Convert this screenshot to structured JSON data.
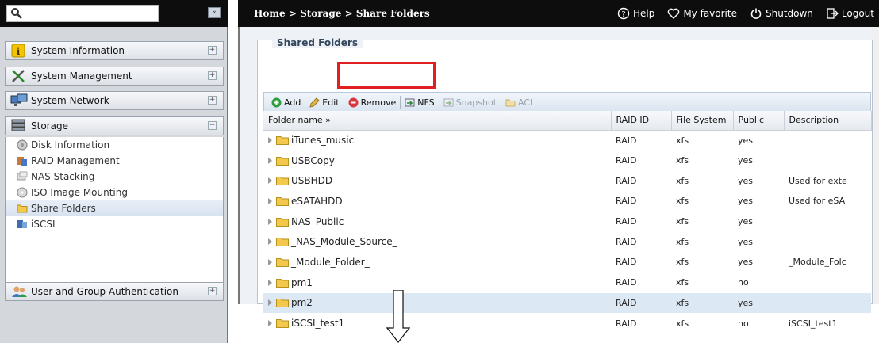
{
  "header": {
    "breadcrumb": "Home > Storage > Share Folders",
    "nav": [
      {
        "label": "Help",
        "icon": "help-icon"
      },
      {
        "label": "My favorite",
        "icon": "heart-icon"
      },
      {
        "label": "Shutdown",
        "icon": "power-icon"
      },
      {
        "label": "Logout",
        "icon": "logout-icon"
      }
    ],
    "collapse_label": "«"
  },
  "sidebar": {
    "panels": [
      {
        "label": "System Information",
        "icon": "info-icon"
      },
      {
        "label": "System Management",
        "icon": "tools-icon"
      },
      {
        "label": "System Network",
        "icon": "network-icon"
      },
      {
        "label": "Storage",
        "icon": "storage-icon"
      },
      {
        "label": "User and Group Authentication",
        "icon": "users-icon"
      }
    ],
    "storage_items": [
      {
        "label": "Disk Information",
        "icon": "disk-icon"
      },
      {
        "label": "RAID Management",
        "icon": "raid-icon"
      },
      {
        "label": "NAS Stacking",
        "icon": "stacking-icon"
      },
      {
        "label": "ISO Image Mounting",
        "icon": "iso-icon"
      },
      {
        "label": "Share Folders",
        "icon": "folder-icon",
        "active": true
      },
      {
        "label": "iSCSI",
        "icon": "iscsi-icon"
      }
    ],
    "expand_glyph": "+",
    "collapse_glyph": "−"
  },
  "main": {
    "section_title": "Shared Folders",
    "toolbar": [
      {
        "label": "Add",
        "icon": "add-icon",
        "enabled": true
      },
      {
        "label": "Edit",
        "icon": "edit-icon",
        "enabled": true
      },
      {
        "label": "Remove",
        "icon": "remove-icon",
        "enabled": true,
        "highlighted": true
      },
      {
        "label": "NFS",
        "icon": "nfs-icon",
        "enabled": true
      },
      {
        "label": "Snapshot",
        "icon": "snapshot-icon",
        "enabled": false
      },
      {
        "label": "ACL",
        "icon": "acl-icon",
        "enabled": false
      }
    ],
    "columns": [
      "Folder name »",
      "RAID ID",
      "File System",
      "Public",
      "Description"
    ],
    "rows": [
      {
        "name": "iTunes_music",
        "raid": "RAID",
        "fs": "xfs",
        "public": "yes",
        "desc": ""
      },
      {
        "name": "USBCopy",
        "raid": "RAID",
        "fs": "xfs",
        "public": "yes",
        "desc": ""
      },
      {
        "name": "USBHDD",
        "raid": "RAID",
        "fs": "xfs",
        "public": "yes",
        "desc": "Used for exte"
      },
      {
        "name": "eSATAHDD",
        "raid": "RAID",
        "fs": "xfs",
        "public": "yes",
        "desc": "Used for eSA"
      },
      {
        "name": "NAS_Public",
        "raid": "RAID",
        "fs": "xfs",
        "public": "yes",
        "desc": ""
      },
      {
        "name": "_NAS_Module_Source_",
        "raid": "RAID",
        "fs": "xfs",
        "public": "yes",
        "desc": ""
      },
      {
        "name": "_Module_Folder_",
        "raid": "RAID",
        "fs": "xfs",
        "public": "yes",
        "desc": "_Module_Folc"
      },
      {
        "name": "pm1",
        "raid": "RAID",
        "fs": "xfs",
        "public": "no",
        "desc": ""
      },
      {
        "name": "pm2",
        "raid": "RAID",
        "fs": "xfs",
        "public": "yes",
        "desc": "",
        "selected": true
      },
      {
        "name": "iSCSI_test1",
        "raid": "RAID",
        "fs": "xfs",
        "public": "no",
        "desc": "iSCSI_test1"
      }
    ]
  },
  "colors": {
    "top_bar": "#0d0d0d",
    "highlight": "#e02020",
    "selected_row": "#dde8f5",
    "folder": "#f2c94c"
  }
}
